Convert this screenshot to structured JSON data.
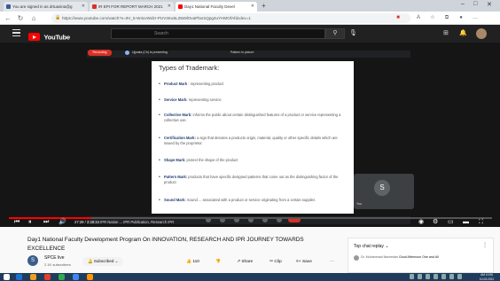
{
  "browser": {
    "tabs": [
      {
        "label": "You are signed in as drtuasina@g",
        "favicon_color": "#3b5998",
        "active": false
      },
      {
        "label": "IR EPI FOR REPORT MARCH 2021",
        "favicon_color": "#d93025",
        "active": false
      },
      {
        "label": "Day1 National Faculty Devel",
        "favicon_color": "#ff0000",
        "active": true
      }
    ],
    "new_tab_label": "+",
    "window_controls": [
      "–",
      "□",
      "✕"
    ],
    "url": "https://www.youtube.com/watch?v=9V_5-W4xvWdzr-PUV4Ku5LZ6s9lOvaPbomQpg4uYHMOfAfdcdev=1"
  },
  "youtube": {
    "logo_text": "YouTube",
    "country_code": "IN",
    "search_placeholder": "Search",
    "header_icons": [
      "create-icon",
      "bell-icon"
    ]
  },
  "meet": {
    "recording_label": "Recording",
    "presenting_label": "Ujjwala (Ch) is presenting",
    "pip_label": "Pattern in picture",
    "participant_initial": "S",
    "participant_name": "You",
    "bottom_left": "9:54 PM | IPR Nation Research IPR"
  },
  "slide": {
    "title": "Types of Trademark:",
    "bullets": [
      {
        "term": "Product Mark",
        "text": " : representing product"
      },
      {
        "term": "Service Mark:",
        "text": " representing service"
      },
      {
        "term": "Collective Mark:",
        "text": " informs the public about certain distinguished features of a product or service representing a collective use."
      },
      {
        "term": "Certification Mark:",
        "text": " a sign that denotes a products origin, material, quality or other specific details which are issued by the proprietor."
      },
      {
        "term": "Shape Mark:",
        "text": " protect the shape of the product"
      },
      {
        "term": "Pattern Mark:",
        "text": " products that have specific designed patterns that come out as the distinguishing factor of the product"
      },
      {
        "term": "Sound Mark:",
        "text": " Sound ... associated with a product or service originating from a certain supplier."
      }
    ]
  },
  "player": {
    "progress_fraction": 0.17,
    "time": "27:29 / 2:28:34",
    "chapter": "IPR Nation ... IPR Publication, Research IPR"
  },
  "video": {
    "title": "Day1 National Faculty Development Program On INNOVATION, RESEARCH AND IPR JOURNEY TOWARDS EXCELLENCE",
    "channel_initial": "S",
    "channel_name": "SPCE live",
    "channel_subs": "2.1K subscribers",
    "subscribe_label": "Subscribed",
    "like_count": "110",
    "share_label": "Share",
    "clip_label": "Clip",
    "save_label": "Save",
    "more_label": "···"
  },
  "chat": {
    "header": "Top chat replay",
    "message_author": "Dr. Muhammad Naveedan",
    "message_text": "Good Afternoon One and All"
  },
  "taskbar": {
    "time": "AM 10:55",
    "date": "10-03-2021",
    "app_colors": [
      "#ffffff",
      "#1f6fd1",
      "#f0a020",
      "#e04030",
      "#34a853",
      "#4285f4",
      "#ff9800"
    ]
  }
}
